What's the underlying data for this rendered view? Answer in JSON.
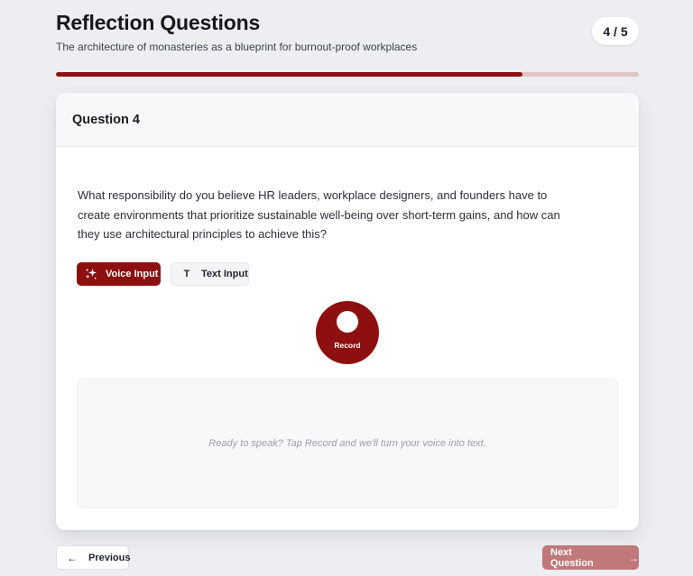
{
  "header": {
    "title": "Reflection Questions",
    "subtitle": "The architecture of monasteries as a blueprint for burnout-proof workplaces",
    "counter": "4 / 5"
  },
  "progress": {
    "current": 4,
    "total": 5,
    "fraction": 0.8
  },
  "card": {
    "heading": "Question 4",
    "question": "What responsibility do you believe HR leaders, workplace designers, and founders have to create environments that prioritize sustainable well-being over short-term gains, and how can they use architectural principles to achieve this?"
  },
  "input_modes": {
    "voice_label": "Voice Input",
    "voice_icon": "sparkles-icon",
    "text_label": "Text Input",
    "text_icon_glyph": "T",
    "selected": "voice"
  },
  "record": {
    "label": "Record"
  },
  "transcript": {
    "placeholder": "Ready to speak? Tap Record and we'll turn your voice into text."
  },
  "nav": {
    "previous_label": "Previous",
    "previous_icon": "arrow-left-icon",
    "next_label": "Next Question",
    "next_icon": "arrow-right-icon"
  },
  "colors": {
    "accent": "#8e0f0f",
    "progress_track": "#dfc4c6",
    "next_disabled": "#c0787a",
    "background": "#eceef2"
  }
}
